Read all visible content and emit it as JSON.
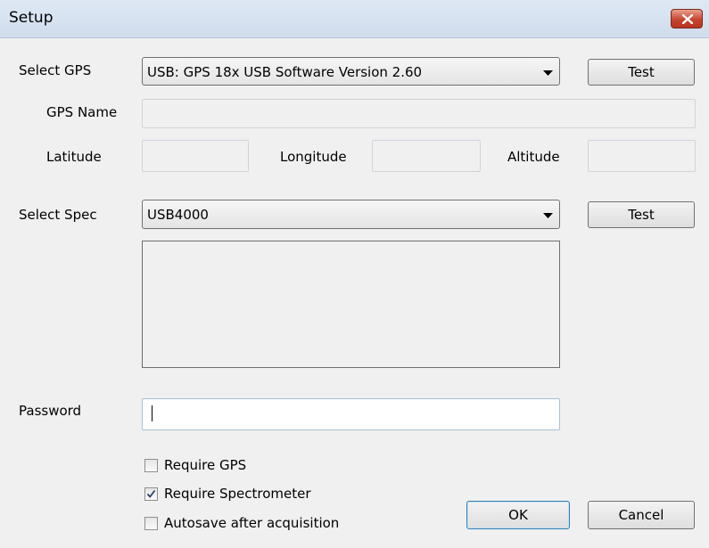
{
  "window": {
    "title": "Setup"
  },
  "gps": {
    "select_label": "Select GPS",
    "selected": "USB: GPS 18x USB Software Version 2.60",
    "test_label": "Test",
    "name_label": "GPS Name",
    "name_value": "",
    "latitude_label": "Latitude",
    "latitude_value": "",
    "longitude_label": "Longitude",
    "longitude_value": "",
    "altitude_label": "Altitude",
    "altitude_value": ""
  },
  "spec": {
    "select_label": "Select Spec",
    "selected": "USB4000",
    "test_label": "Test"
  },
  "password": {
    "label": "Password",
    "value": ""
  },
  "options": {
    "require_gps": {
      "label": "Require GPS",
      "checked": false
    },
    "require_spectrometer": {
      "label": "Require Spectrometer",
      "checked": true
    },
    "autosave": {
      "label": "Autosave after acquisition",
      "checked": false
    }
  },
  "buttons": {
    "ok": "OK",
    "cancel": "Cancel"
  },
  "icons": {
    "close": "close-icon",
    "dropdown": "chevron-down-icon",
    "checkmark": "checkmark-icon"
  },
  "colors": {
    "close_button": "#c7452f",
    "default_button_border": "#3c7fb1",
    "dialog_background": "#f0f0f0"
  }
}
